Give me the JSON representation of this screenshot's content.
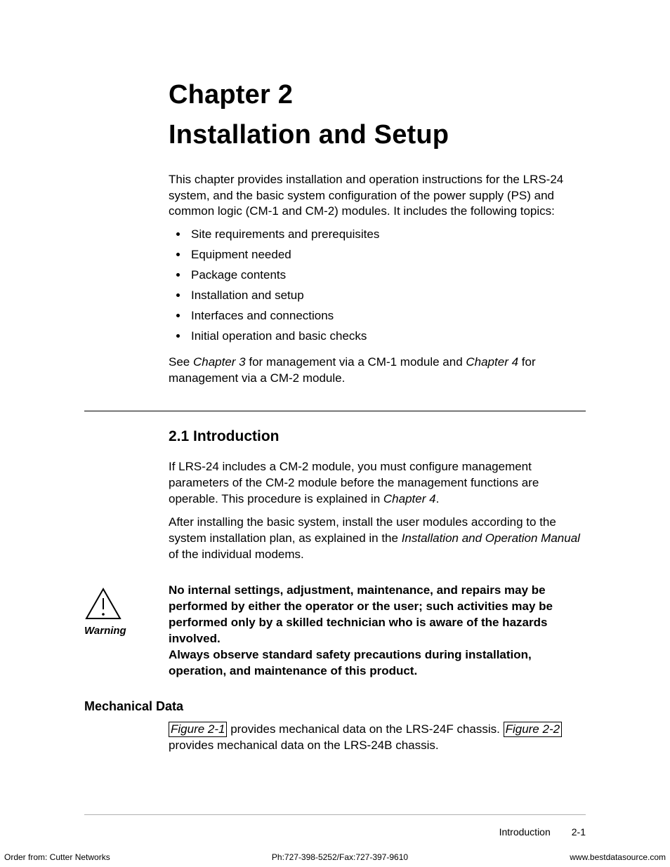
{
  "chapter": {
    "label": "Chapter 2",
    "title": "Installation and Setup"
  },
  "intro_para": "This chapter provides installation and operation instructions for the LRS-24 system, and the basic system configuration of the power supply (PS) and common logic (CM-1 and CM-2) modules. It includes the following topics:",
  "topics": [
    "Site requirements and prerequisites",
    "Equipment needed",
    "Package contents",
    "Installation and setup",
    "Interfaces and connections",
    "Initial operation and basic checks"
  ],
  "see_para": {
    "pre": "See ",
    "ch3": "Chapter 3",
    "mid": " for management via a CM-1 module and ",
    "ch4": "Chapter 4",
    "post": " for management via a CM-2 module."
  },
  "section21": {
    "heading": "2.1  Introduction",
    "p1": {
      "pre": "If LRS-24 includes a CM-2 module, you must configure management parameters of the CM-2 module before the management functions are operable. This procedure is explained in ",
      "ch": "Chapter 4",
      "post": "."
    },
    "p2": {
      "pre": "After installing the basic system, install the user modules according to the system installation plan, as explained in the ",
      "manual": "Installation and Operation Manual",
      "post": " of the individual modems."
    }
  },
  "warning": {
    "label": "Warning",
    "line1": "No internal settings, adjustment, maintenance, and repairs may be performed by either the operator or the user; such activities may be performed only by a skilled technician who is aware of the hazards involved.",
    "line2": "Always observe standard safety precautions during installation, operation, and maintenance of this product."
  },
  "mech": {
    "heading": "Mechanical Data",
    "fig1": "Figure 2-1",
    "mid1": " provides mechanical data on the LRS-24F chassis. ",
    "fig2": "Figure 2-2",
    "post": " provides mechanical data on the LRS-24B chassis."
  },
  "footer": {
    "section": "Introduction",
    "pagenum": "2-1"
  },
  "printline": {
    "left": "Order from: Cutter Networks",
    "center": "Ph:727-398-5252/Fax:727-397-9610",
    "right": "www.bestdatasource.com"
  }
}
